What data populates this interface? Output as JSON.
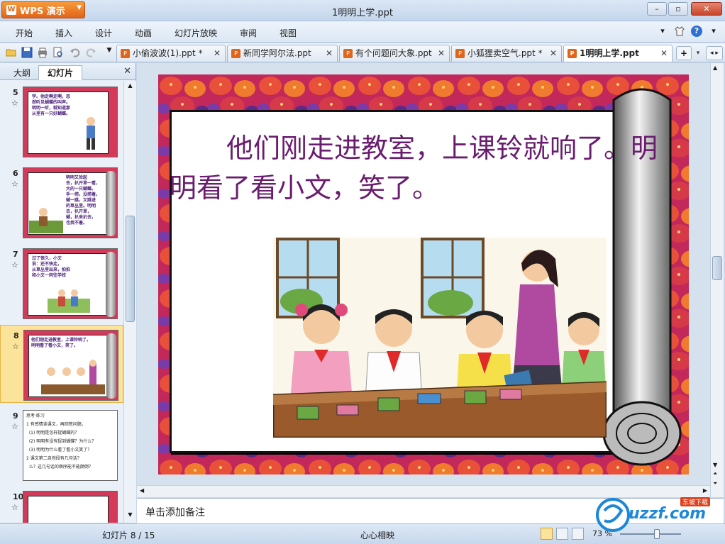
{
  "app": {
    "menu_button": "WPS 演示",
    "window_title": "1明明上学.ppt",
    "controls": {
      "minimize": "–",
      "maximize": "▫",
      "close": "✕"
    }
  },
  "menu": {
    "items": [
      "开始",
      "插入",
      "设计",
      "动画",
      "幻灯片放映",
      "审阅",
      "视图"
    ]
  },
  "toolbar": {
    "icons": [
      "open-folder-icon",
      "save-icon",
      "print-icon",
      "print-preview-icon",
      "undo-icon",
      "redo-icon",
      "customize-dropdown-icon"
    ]
  },
  "doc_tabs": [
    {
      "label": "小偷波波(1).ppt *",
      "active": false
    },
    {
      "label": "新同学阿尔法.ppt",
      "active": false
    },
    {
      "label": "有个问题问大象.ppt",
      "active": false
    },
    {
      "label": "小狐狸卖空气.ppt *",
      "active": false
    },
    {
      "label": "1明明上学.ppt",
      "active": true
    }
  ],
  "left_panel": {
    "tabs": [
      "大纲",
      "幻灯片"
    ],
    "active_tab": "幻灯片",
    "close": "✕",
    "thumbnails": [
      {
        "number": "5",
        "text": "学。他走啊走啊，忽\n然听见蝴蝶的叫声。\n明明一听，就知道那\n从里有一只好蝴蝶。"
      },
      {
        "number": "6",
        "text": "明明又捡起\n去，扒开草一看，\n大的一只蝴蝶。\n手一捞。没捞着。\n蝴一跳，又跳进\n的草丛里。明明\n去，扒开草，\n蝴，扒来扒去，\n也找不着。"
      },
      {
        "number": "7",
        "text": "过了很久，小文\n说：还不快走，\n从草丛里出来，拍拍\n和小文一同往学校"
      },
      {
        "number": "8",
        "text": "他们刚走进教室，上课铃响了。\n明明看了看小文，笑了。"
      },
      {
        "number": "9",
        "text": "思考·练习\n1 有感情读课文，再回答问题。\n  (1) 明明是怎样捉蝴蝶的？\n  (2) 明明有没有捉到蝴蝶？为什么？\n  (3) 明明为什么看了看小文笑了？\n2 课文第二自然段有几句话？\n  么？这几句话的顺序能不能颠倒？"
      },
      {
        "number": "10",
        "text": ""
      }
    ],
    "selected": "8"
  },
  "slide": {
    "text": "他们刚走进教室，上课铃就响了。明明看了看小文，笑了。"
  },
  "notes": {
    "placeholder": "单击添加备注"
  },
  "status": {
    "slide_counter": "幻灯片 8 / 15",
    "theme": "心心相映",
    "zoom": "73 %"
  },
  "watermark": {
    "text": "uzzf.com",
    "sub": "东坡下载"
  },
  "colors": {
    "accent_orange": "#e0641a",
    "slide_text": "#6a1d6e",
    "selected_thumb": "#fbe39a",
    "chrome_blue": "#c8d8ea"
  }
}
